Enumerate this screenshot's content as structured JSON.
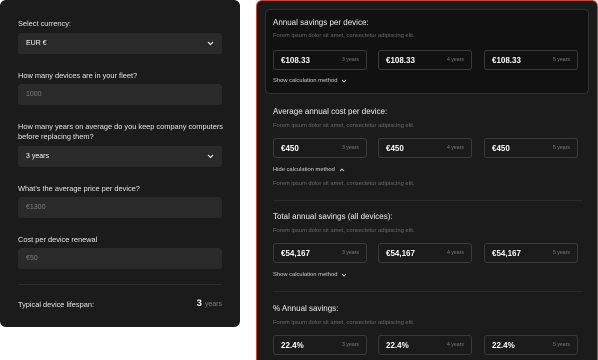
{
  "form": {
    "currency": {
      "label": "Select currency:",
      "value": "EUR €"
    },
    "devices": {
      "label": "How many devices are in your fleet?",
      "placeholder": "1000"
    },
    "years": {
      "label_line1": "How many years on average do you keep company computers",
      "label_line2": "before replacing them?",
      "value": "3 years"
    },
    "price": {
      "label": "What’s the average price per device?",
      "placeholder": "€1300"
    },
    "renewal": {
      "label": "Cost per device renewal",
      "placeholder": "€50"
    },
    "lifespan": {
      "label": "Typical device lifespan:",
      "value": "3",
      "unit": "years"
    }
  },
  "results": {
    "sections": [
      {
        "title": "Annual savings per device:",
        "subtitle": "Forem ipsum dolor sit amet, consectetur adipiscing elit.",
        "values": [
          {
            "amount": "€108.33",
            "years": "3 years"
          },
          {
            "amount": "€108.33",
            "years": "4 years"
          },
          {
            "amount": "€108.33",
            "years": "5 years"
          }
        ],
        "toggle": "Show calculation method"
      },
      {
        "title": "Average annual cost per device:",
        "subtitle": "Forem ipsum dolor sit amet, consectetur adipiscing elit.",
        "values": [
          {
            "amount": "€450",
            "years": "3 years"
          },
          {
            "amount": "€450",
            "years": "4 years"
          },
          {
            "amount": "€450",
            "years": "5 years"
          }
        ],
        "toggle": "Hide calculation method",
        "method_text": "Forem ipsum dolor sit amet, consectetur adipiscing elit."
      },
      {
        "title": "Total annual savings (all devices):",
        "subtitle": "Forem ipsum dolor sit amet, consectetur adipiscing elit.",
        "values": [
          {
            "amount": "€54,167",
            "years": "3 years"
          },
          {
            "amount": "€54,167",
            "years": "4 years"
          },
          {
            "amount": "€54,167",
            "years": "5 years"
          }
        ],
        "toggle": "Show calculation method"
      },
      {
        "title": "% Annual savings:",
        "subtitle": "Forem ipsum dolor sit amet, consectetur adipiscing elit.",
        "values": [
          {
            "amount": "22.4%",
            "years": "3 years"
          },
          {
            "amount": "22.4%",
            "years": "4 years"
          },
          {
            "amount": "22.4%",
            "years": "5 years"
          }
        ]
      }
    ]
  },
  "icons": {
    "chevron_down": "chevron-down-icon",
    "chevron_up": "chevron-up-icon"
  },
  "colors": {
    "panel_bg": "#1b1b1b",
    "field_bg": "#2a2a2a",
    "accent_border": "#c8452f"
  }
}
